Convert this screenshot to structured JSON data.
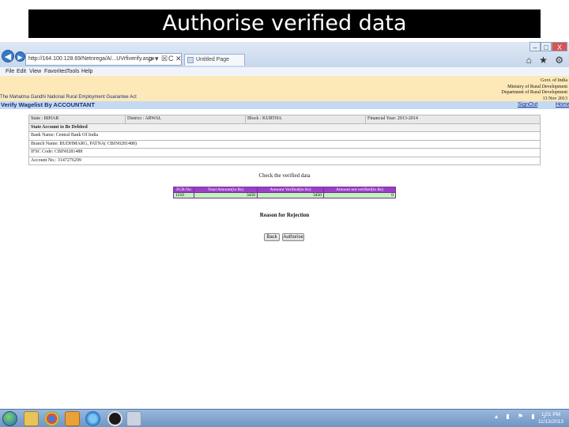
{
  "slide": {
    "title": "Authorise verified data"
  },
  "browser": {
    "address": "http://164.100.128.69/Netnrega/A/...UVrfiverify.aspx",
    "address_controls": [
      "ρ",
      "▾",
      "☒",
      "C",
      "✕"
    ],
    "tab_label": "Untitled Page",
    "window_buttons": [
      "–",
      "□",
      "X"
    ],
    "right_icons": "⌂ ★ ⚙",
    "menu": [
      "File",
      "Edit",
      "View",
      "Favorites",
      "Tools",
      "Help"
    ]
  },
  "header": {
    "govt_lines": [
      "Govt. of India",
      "Ministry of Rural Development",
      "Department of Rural Development",
      "13 Nov 2013"
    ],
    "scheme_name": "The Mahatma Gandhi National Rural Employment Guarantee Act",
    "page_title": "Verify Wagelist By ACCOUNTANT",
    "signout_label": "SignOut",
    "home_label": "Home"
  },
  "account": {
    "state": "State : BIHAR",
    "district": "District : ARWAL",
    "block": "Block : KURTHA",
    "financial_year": "Financial Year: 2013-2014",
    "section_label": "State Account to Be Debited",
    "bank_name": "Bank Name: Central Bank Of India",
    "branch_name": "Branch Name: BUDHMARG, PATNA( CBIN0281488)",
    "ifsc": "IFSC Code: CBIN0281488",
    "account_no": "Account No.: 3147276299"
  },
  "verify": {
    "title": "Check the verified data",
    "headers": [
      "FCB No",
      "Total Amount(in Rs)",
      "Amount Verified(in Rs)",
      "Amount not verified(in Rs)"
    ],
    "row": [
      "1210",
      "3450",
      "3450",
      "0"
    ]
  },
  "reason_label": "Reason for Rejection",
  "buttons": {
    "back": "Back",
    "authorise": "Authorise"
  },
  "taskbar": {
    "time": "1:01 PM",
    "date": "11/13/2013",
    "tray_icons": "▴ ▮ ⚑ ▮ ♪"
  },
  "colors": {
    "header_bg": "#fde9b8",
    "title_bar_bg": "#c5d9f1",
    "table_header_purple": "#9b3fc7",
    "table_row_green": "#bff3b8"
  }
}
